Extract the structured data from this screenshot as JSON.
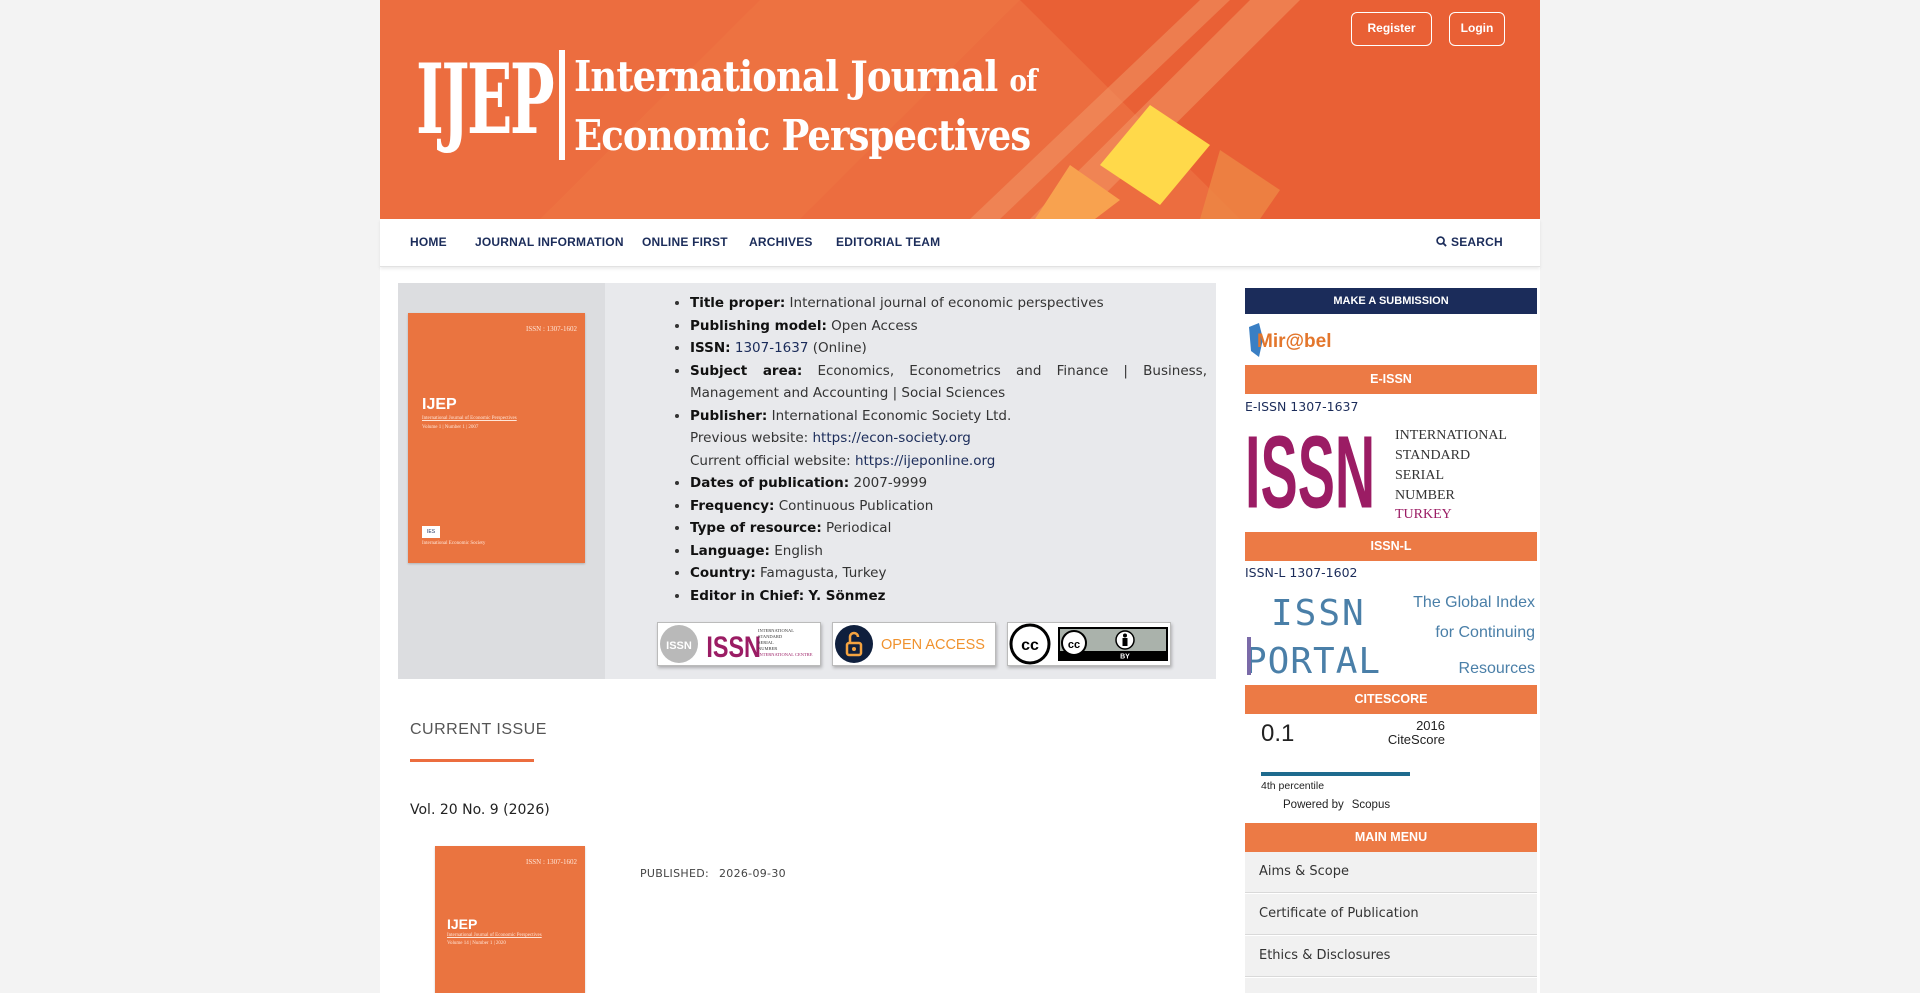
{
  "header": {
    "logo_abbr": "IJEP",
    "logo_line1_a": "International Journal ",
    "logo_line1_b": "of",
    "logo_line2": "Economic Perspectives",
    "register_label": "Register",
    "login_label": "Login",
    "brand_color": "#ec6d3f"
  },
  "nav": {
    "items": [
      "HOME",
      "JOURNAL INFORMATION",
      "ONLINE FIRST",
      "ARCHIVES",
      "EDITORIAL TEAM"
    ],
    "search_label": "SEARCH"
  },
  "cover": {
    "issn": "ISSN : 1307-1602",
    "title": "IJEP",
    "subtitle": "International Journal of Economic Perspectives",
    "volume": "Volume 1 | Number 1 | 2007",
    "footer": "International Economic Society",
    "emblem": "IES"
  },
  "info": {
    "title_label": "Title proper:",
    "title_value": "International journal of economic perspectives",
    "model_label": "Publishing model:",
    "model_value": "Open Access",
    "issn_label": "ISSN:",
    "issn_link": "1307-1637",
    "issn_suffix": "(Online)",
    "subject_label": "Subject area:",
    "subject_value": "Economics, Econometrics and Finance | Business, Management and Accounting | Social Sciences",
    "publisher_label": "Publisher:",
    "publisher_value": "International Economic Society Ltd.",
    "prev_site_label": "Previous website:",
    "prev_site_link": "https://econ-society.org",
    "curr_site_label": "Current official website:",
    "curr_site_link": "https://ijeponline.org",
    "dates_label": "Dates of publication:",
    "dates_value": "2007-9999",
    "frequency_label": "Frequency:",
    "frequency_value": "Continuous Publication",
    "type_label": "Type of resource:",
    "type_value": "Periodical",
    "language_label": "Language:",
    "language_value": "English",
    "country_label": "Country:",
    "country_value": "Famagusta, Turkey",
    "editor_label": "Editor in Chief:",
    "editor_value": "Y. Sönmez"
  },
  "badges": {
    "issn_word": "ISSN",
    "issn_small": [
      "INTERNATIONAL",
      "STANDARD",
      "SERIAL",
      "NUMBER",
      "INTERNATIONAL CENTRE"
    ],
    "open_access": "OPEN ACCESS",
    "cc_by": "BY"
  },
  "current_issue": {
    "heading": "CURRENT ISSUE",
    "volume": "Vol. 20 No. 9 (2026)",
    "published_label": "PUBLISHED:",
    "published_date": "2026-09-30",
    "cover_issn": "ISSN : 1307-1602",
    "cover_subtitle": "International Journal of Economic Perspectives",
    "cover_volume": "Volume 14 | Number 1 | 2020"
  },
  "sidebar": {
    "submit_label": "MAKE A SUBMISSION",
    "mirabel": "Mir@bel",
    "eissn_heading": "E-ISSN",
    "eissn_text": "E-ISSN 1307-1637",
    "issn_logo_word": "ISSN",
    "issn_logo_lines": [
      "INTERNATIONAL",
      "STANDARD",
      "SERIAL",
      "NUMBER"
    ],
    "issn_logo_country": "TURKEY",
    "issnl_heading": "ISSN-L",
    "issnl_text": "ISSN-L 1307-1602",
    "portal_word1": "ISSN",
    "portal_word2": "PORTAL",
    "portal_lines": [
      "The Global Index",
      "for Continuing",
      "Resources"
    ],
    "citescore_heading": "CITESCORE",
    "citescore_value": "0.1",
    "citescore_year": "2016",
    "citescore_label": "CiteScore",
    "citescore_percentile": "4th percentile",
    "powered_by": "Powered by",
    "scopus": "Scopus",
    "main_menu_heading": "MAIN MENU",
    "menu_items": [
      "Aims & Scope",
      "Certificate of Publication",
      "Ethics & Disclosures"
    ]
  }
}
